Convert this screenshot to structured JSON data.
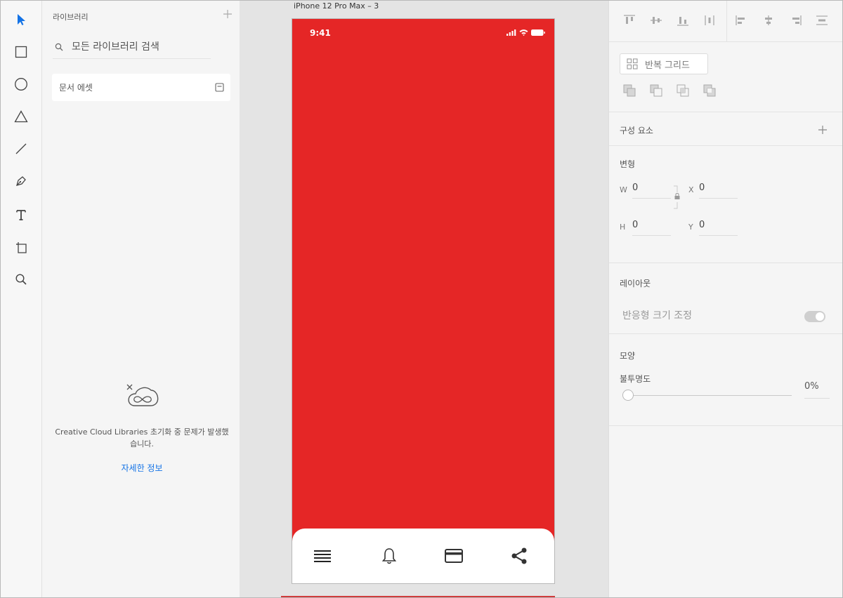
{
  "colors": {
    "accent": "#1473e6",
    "artboard_fill": "#e52626",
    "selection": "#1473e6"
  },
  "tools": [
    {
      "name": "select-tool",
      "icon": "arrow-pointer-icon"
    },
    {
      "name": "rectangle-tool",
      "icon": "rectangle-icon"
    },
    {
      "name": "ellipse-tool",
      "icon": "circle-icon"
    },
    {
      "name": "polygon-tool",
      "icon": "triangle-icon"
    },
    {
      "name": "line-tool",
      "icon": "line-icon"
    },
    {
      "name": "pen-tool",
      "icon": "pen-icon"
    },
    {
      "name": "text-tool",
      "icon": "text-icon"
    },
    {
      "name": "artboard-tool",
      "icon": "artboard-icon"
    },
    {
      "name": "zoom-tool",
      "icon": "magnifier-icon"
    }
  ],
  "library": {
    "title": "라이브러리",
    "search_placeholder": "모든 라이브러리 검색",
    "document_assets": "문서 에셋",
    "error_message": "Creative Cloud Libraries 초기화 중 문제가 발생했습니다.",
    "more_info": "자세한 정보"
  },
  "canvas": {
    "artboard_name": "iPhone 12 Pro Max – 3",
    "status_time": "9:41",
    "tabbar_icons": [
      "menu-icon",
      "bell-icon",
      "card-icon",
      "share-icon"
    ]
  },
  "properties": {
    "repeat_grid": "반복 그리드",
    "components": "구성 요소",
    "transform": {
      "title": "변형",
      "w_label": "W",
      "w_value": "0",
      "x_label": "X",
      "x_value": "0",
      "h_label": "H",
      "h_value": "0",
      "y_label": "Y",
      "y_value": "0"
    },
    "layout": {
      "title": "레이아웃",
      "responsive_resize": "반응형 크기 조정",
      "responsive_enabled": true
    },
    "appearance": {
      "title": "모양",
      "opacity_label": "불투명도",
      "opacity_value": "0%",
      "opacity_fraction": 0
    }
  }
}
